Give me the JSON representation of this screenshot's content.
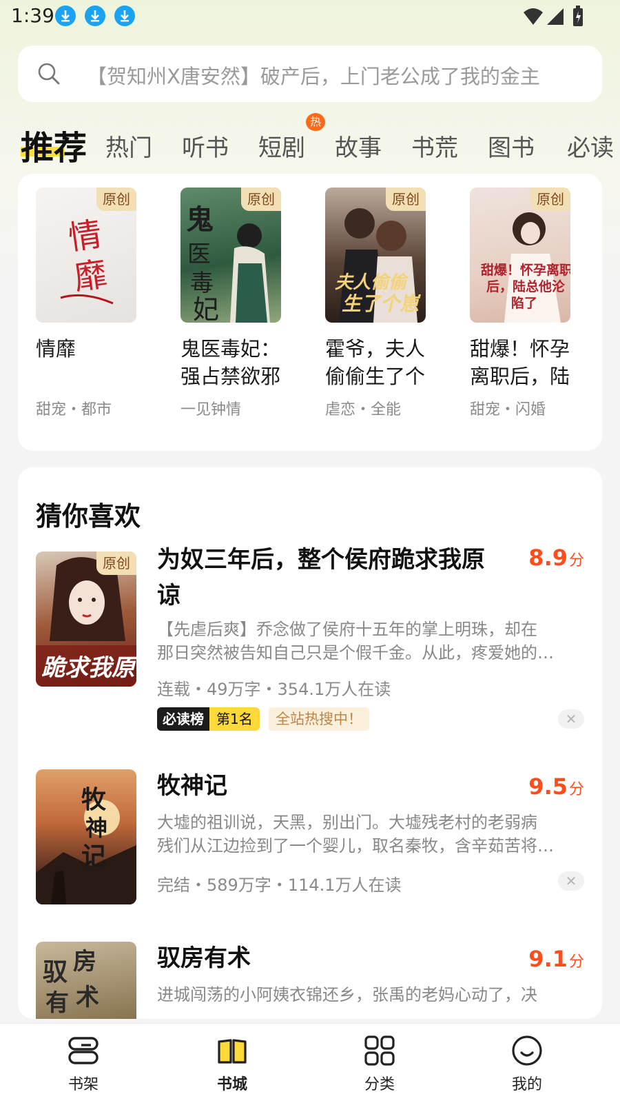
{
  "status_bar": {
    "time": "1:39",
    "download_icons": [
      "download-icon",
      "download-icon",
      "download-icon"
    ]
  },
  "search": {
    "placeholder": "【贺知州X唐安然】破产后，上门老公成了我的金主"
  },
  "tabs": [
    {
      "label": "推荐",
      "active": true
    },
    {
      "label": "热门"
    },
    {
      "label": "听书"
    },
    {
      "label": "短剧",
      "badge": "热"
    },
    {
      "label": "故事"
    },
    {
      "label": "书荒"
    },
    {
      "label": "图书"
    },
    {
      "label": "必读"
    }
  ],
  "recommend": {
    "badge": "原创",
    "books": [
      {
        "title": "情靡",
        "tags": "甜宠・都市",
        "cover_text": "情靡"
      },
      {
        "title": "鬼医毒妃：强占禁欲邪",
        "title_lines": [
          "鬼医毒妃：",
          "强占禁欲邪"
        ],
        "tags": "一见钟情",
        "cover_text": "鬼医毒妃"
      },
      {
        "title": "霍爷，夫人偷偷生了个",
        "title_lines": [
          "霍爷，夫人",
          "偷偷生了个"
        ],
        "tags": "虐恋・全能",
        "cover_text": "夫人偷偷生了个崽"
      },
      {
        "title": "甜爆！怀孕离职后，陆",
        "title_lines": [
          "甜爆！怀孕",
          "离职后，陆"
        ],
        "tags": "甜宠・闪婚",
        "cover_text": "甜爆！怀孕离职后，陆总他沦陷了"
      }
    ]
  },
  "guess": {
    "title": "猜你喜欢",
    "score_unit": "分",
    "books": [
      {
        "title_line1": "为奴三年后，整个侯府跪求我原",
        "title_line2": "谅",
        "score": "8.9",
        "badge": "原创",
        "desc_line1": "【先虐后爽】乔念做了侯府十五年的掌上明珠，却在",
        "desc_line2": "那日突然被告知自己只是个假千金。从此，疼爱她的…",
        "meta": "连载・49万字・354.1万人在读",
        "rank_label": "必读榜",
        "rank_value": "第1名",
        "hot_tag": "全站热搜中！",
        "cover_text": "跪求我原谅"
      },
      {
        "title_line1": "牧神记",
        "score": "9.5",
        "desc_line1": "大墟的祖训说，天黑，别出门。大墟残老村的老弱病",
        "desc_line2": "残们从江边捡到了一个婴儿，取名秦牧，含辛茹苦将…",
        "meta": "完结・589万字・114.1万人在读",
        "cover_text": "牧神记"
      },
      {
        "title_line1": "驭房有术",
        "score": "9.1",
        "desc_line1": "进城闯荡的小阿姨衣锦还乡，张禹的老妈心动了，决",
        "cover_text": "驭房有术"
      }
    ]
  },
  "bottom_nav": [
    {
      "label": "书架",
      "icon": "bookshelf-icon"
    },
    {
      "label": "书城",
      "icon": "bookstore-icon",
      "active": true
    },
    {
      "label": "分类",
      "icon": "category-icon"
    },
    {
      "label": "我的",
      "icon": "profile-icon"
    }
  ],
  "colors": {
    "accent_yellow": "#ffd83a",
    "score_red": "#ff4d1c",
    "hot_orange": "#ff6a1a",
    "download_blue": "#1aa3f2"
  }
}
